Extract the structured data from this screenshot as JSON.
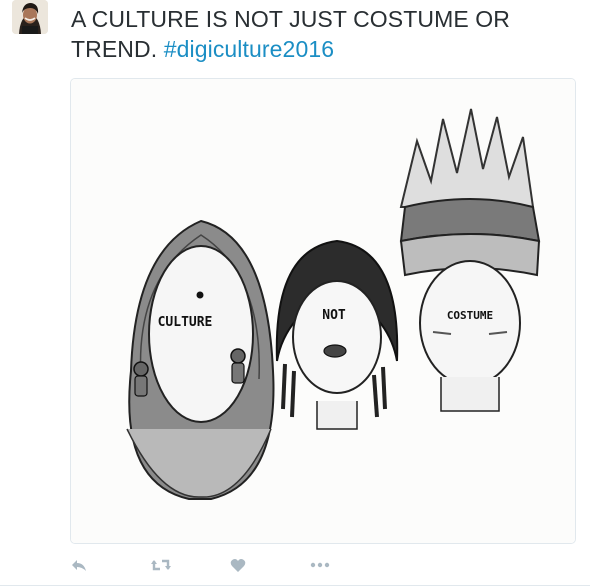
{
  "tweet": {
    "text_plain": "A CULTURE IS NOT JUST COSTUME OR TREND.",
    "hashtag": "#digiculture2016"
  },
  "media": {
    "labels": {
      "left": "CULTURE",
      "middle": "NOT",
      "right": "COSTUME"
    }
  },
  "actions": {
    "reply_icon": "reply-icon",
    "retweet_icon": "retweet-icon",
    "like_icon": "heart-icon",
    "more_icon": "more-icon"
  },
  "colors": {
    "text": "#292f33",
    "hashtag": "#1b8ec4",
    "icon": "#aab8c2"
  }
}
